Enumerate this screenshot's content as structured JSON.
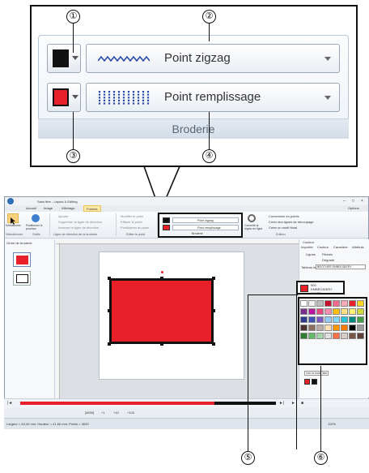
{
  "callout": {
    "markers": [
      "①",
      "②",
      "③",
      "④",
      "⑤",
      "⑥"
    ],
    "outline_row": {
      "stitch_label": "Point zigzag",
      "color": "#111111"
    },
    "fill_row": {
      "stitch_label": "Point remplissage",
      "color": "#e8202a"
    },
    "group_label": "Broderie"
  },
  "app": {
    "window_title": "Sans titre - Layout & Editing",
    "window_controls": [
      "–",
      "□",
      "×"
    ],
    "tabs": [
      "Accueil",
      "Image",
      "Affichage",
      "Formes"
    ],
    "active_tab": "Formes",
    "options_label": "Options",
    "ribbon": {
      "select_label": "Sélectionner",
      "position_label": "Positionner le pourtour",
      "group_select": "Sélectionner",
      "group_outils": "Outils",
      "line_items": [
        "Ajouter",
        "Supprimer la ligne de direction",
        "Inverser la ligne de direction"
      ],
      "group_line": "Ligne de direction de la broderie",
      "stitch_items": [
        "Modifier le point",
        "Effacer le point",
        "Positionner au point"
      ],
      "group_stitch": "Editer le point",
      "mini_outline_label": "Point zigzag",
      "mini_fill_label": "Point remplissage",
      "group_broderie": "Broderie",
      "convert_label": "Convertir la région en ligne",
      "edition_items": [
        "Conversion en points",
        "Créer des lignes de découpage",
        "Créer un motif floral"
      ],
      "group_edition": "Edition"
    },
    "left_panel": {
      "title": "Ordre de broderie"
    },
    "right_panel": {
      "title": "Couleur",
      "tabs": [
        "Importer",
        "Couleur",
        "Caractère",
        "Attributs"
      ],
      "fill_options": [
        "Lignes",
        "Pleines",
        "Dégradé"
      ],
      "table_label": "Tableau des",
      "table_value": "BROTHER EMBROIDERY",
      "thread_number": "900",
      "thread_name": "EMBROIDERY",
      "thread_extra": "WHITE",
      "view_all_label": "Voir la toute liste"
    },
    "palette": [
      "#ffffff",
      "#f2f2f2",
      "#bdbdbd",
      "#c8102e",
      "#f26b8a",
      "#f7a8b8",
      "#e8202a",
      "#f9d423",
      "#7b2c8f",
      "#b5179e",
      "#e64980",
      "#f48fb1",
      "#ffc107",
      "#ffe082",
      "#fff176",
      "#cddc39",
      "#2b3a8c",
      "#3f51b5",
      "#7e57c2",
      "#90caf9",
      "#81d4fa",
      "#26c6da",
      "#00897b",
      "#43a047",
      "#4e342e",
      "#8d6e63",
      "#bcaaa4",
      "#ffe0b2",
      "#ff9800",
      "#f57c00",
      "#000000",
      "#9e9e9e",
      "#2e7d32",
      "#66bb6a",
      "#a5d6a7",
      "#e0e0e0",
      "#ff7043",
      "#d7ccc8",
      "#795548",
      "#5d4037"
    ],
    "recent_colors": [
      "#e8202a",
      "#111111"
    ],
    "timeline": {
      "play_icon": "►",
      "stop_icon": "■",
      "step_icon": "►|"
    },
    "navbar": {
      "fields": [
        "[4630]",
        "+1",
        "+10",
        "+100"
      ]
    },
    "statusbar": {
      "text": "Largeur = 64,40 mm; Hauteur = 41,60 mm; Points = 4630",
      "zoom": "110%"
    }
  }
}
